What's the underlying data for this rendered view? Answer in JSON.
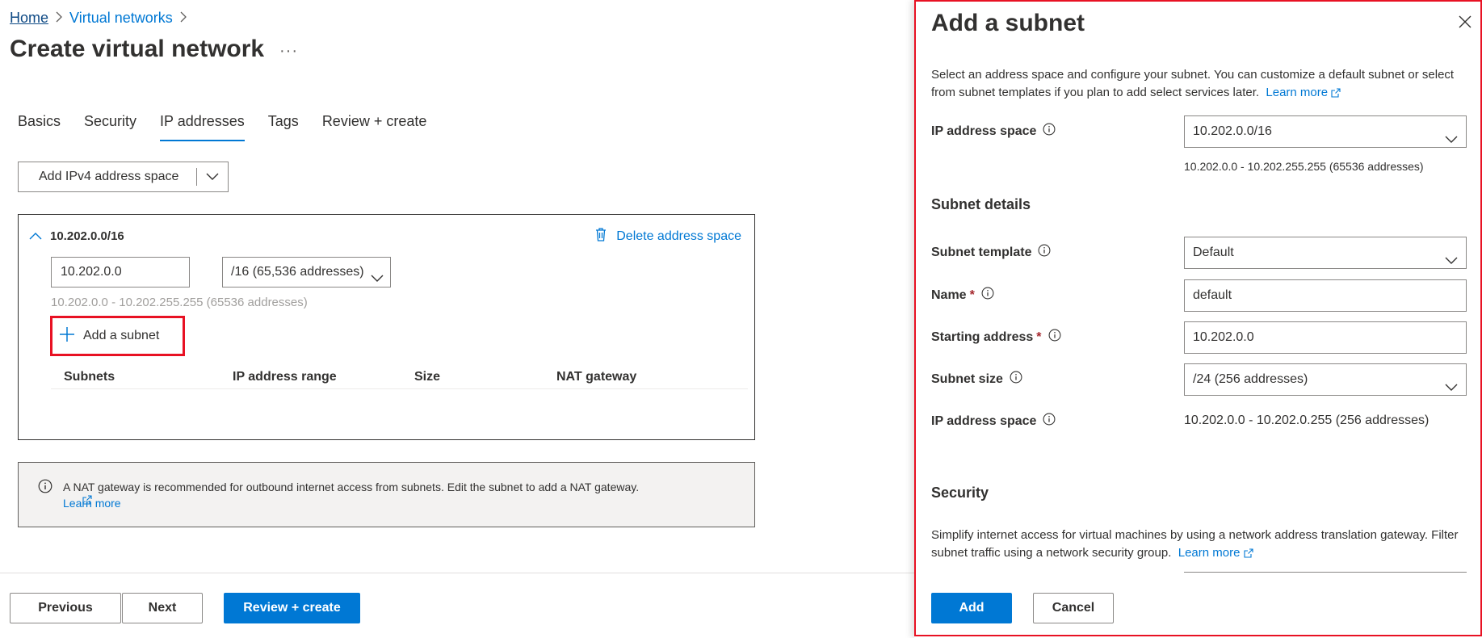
{
  "breadcrumb": {
    "home": "Home",
    "virtual_networks": "Virtual networks"
  },
  "page": {
    "title": "Create virtual network",
    "more": "···"
  },
  "tabs": [
    {
      "label": "Basics"
    },
    {
      "label": "Security"
    },
    {
      "label": "IP addresses",
      "active": true
    },
    {
      "label": "Tags"
    },
    {
      "label": "Review + create"
    }
  ],
  "address_space": {
    "add_button_label": "Add IPv4 address space",
    "cidr": "10.202.0.0/16",
    "delete_label": "Delete address space",
    "address_value": "10.202.0.0",
    "size_value": "/16 (65,536 addresses)",
    "range_text": "10.202.0.0 - 10.202.255.255 (65536 addresses)",
    "add_subnet_label": "Add a subnet",
    "table_headers": [
      "Subnets",
      "IP address range",
      "Size",
      "NAT gateway"
    ]
  },
  "nat_info": {
    "text": "A NAT gateway is recommended for outbound internet access from subnets. Edit the subnet to add a NAT gateway.",
    "link": "Learn more"
  },
  "footer": {
    "previous": "Previous",
    "next": "Next",
    "review_create": "Review + create"
  },
  "panel": {
    "title": "Add a subnet",
    "description": "Select an address space and configure your subnet. You can customize a default subnet or select from subnet templates if you plan to add select services later.",
    "learn_more": "Learn more",
    "ip_address_space_label": "IP address space",
    "ip_address_space_value": "10.202.0.0/16",
    "ip_address_space_range": "10.202.0.0 - 10.202.255.255 (65536 addresses)",
    "subnet_details_title": "Subnet details",
    "subnet_template_label": "Subnet template",
    "subnet_template_value": "Default",
    "name_label": "Name",
    "name_value": "default",
    "starting_address_label": "Starting address",
    "starting_address_value": "10.202.0.0",
    "subnet_size_label": "Subnet size",
    "subnet_size_value": "/24 (256 addresses)",
    "subnet_ip_space_label": "IP address space",
    "subnet_ip_space_value": "10.202.0.0 - 10.202.0.255 (256 addresses)",
    "security_title": "Security",
    "security_desc": "Simplify internet access for virtual machines by using a network address translation gateway. Filter subnet traffic using a network security group.",
    "security_learn_more": "Learn more",
    "required_marker": "*",
    "add_button": "Add",
    "cancel_button": "Cancel"
  },
  "colors": {
    "accent": "#0078d4",
    "highlight": "#e81123",
    "required": "#a4262c"
  }
}
